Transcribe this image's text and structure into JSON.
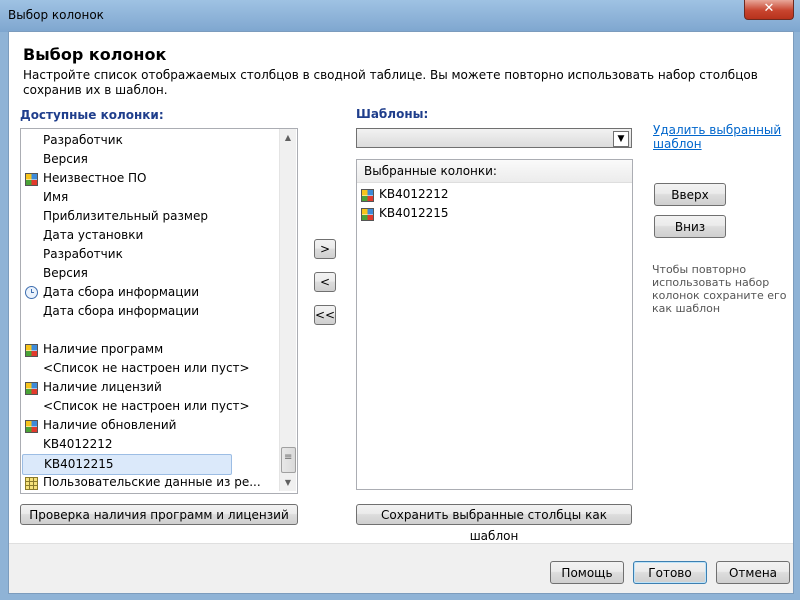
{
  "window": {
    "title": "Выбор колонок",
    "close_glyph": "✕"
  },
  "dialog": {
    "heading": "Выбор колонок",
    "description": "Настройте список отображаемых столбцов в сводной таблице. Вы можете повторно использовать набор столбцов сохранив их в шаблон."
  },
  "available": {
    "label": "Доступные колонки:",
    "items": [
      {
        "label": "Разработчик",
        "icon": ""
      },
      {
        "label": "Версия",
        "icon": ""
      },
      {
        "label": "Неизвестное ПО",
        "icon": "grid-icon"
      },
      {
        "label": "Имя",
        "icon": ""
      },
      {
        "label": "Приблизительный размер",
        "icon": ""
      },
      {
        "label": "Дата установки",
        "icon": ""
      },
      {
        "label": "Разработчик",
        "icon": ""
      },
      {
        "label": "Версия",
        "icon": ""
      },
      {
        "label": "Дата сбора информации",
        "icon": "clock-icon"
      },
      {
        "label": "Дата сбора информации",
        "icon": ""
      },
      {
        "label": "",
        "icon": ""
      },
      {
        "label": "Наличие программ",
        "icon": "grid-icon"
      },
      {
        "label": "<Список не настроен или пуст>",
        "icon": ""
      },
      {
        "label": "Наличие лицензий",
        "icon": "grid-icon"
      },
      {
        "label": "<Список не настроен или пуст>",
        "icon": ""
      },
      {
        "label": "Наличие обновлений",
        "icon": "grid-icon"
      },
      {
        "label": "KB4012212",
        "icon": ""
      },
      {
        "label": "KB4012215",
        "icon": "",
        "selected": true
      },
      {
        "label": "Пользовательские данные из ре...",
        "icon": "table-icon"
      }
    ],
    "check_button": "Проверка наличия программ и лицензий"
  },
  "transfer": {
    "add": ">",
    "remove": "<",
    "remove_all": "<<"
  },
  "templates": {
    "label": "Шаблоны:",
    "selected_value": "",
    "arrow_glyph": "▼",
    "delete_link": "Удалить выбранный шаблон",
    "selected_header": "Выбранные колонки:",
    "selected_items": [
      {
        "label": "KB4012212",
        "icon": "grid-icon"
      },
      {
        "label": "KB4012215",
        "icon": "grid-icon"
      }
    ],
    "save_button": "Сохранить выбранные столбцы как шаблон",
    "up_button": "Вверх",
    "down_button": "Вниз",
    "hint": "Чтобы повторно использовать набор колонок сохраните его как шаблон"
  },
  "scrollbar": {
    "up_glyph": "▲",
    "down_glyph": "▼",
    "grip_glyph": "≡"
  },
  "footer": {
    "help": "Помощь",
    "done": "Готово",
    "cancel": "Отмена"
  }
}
